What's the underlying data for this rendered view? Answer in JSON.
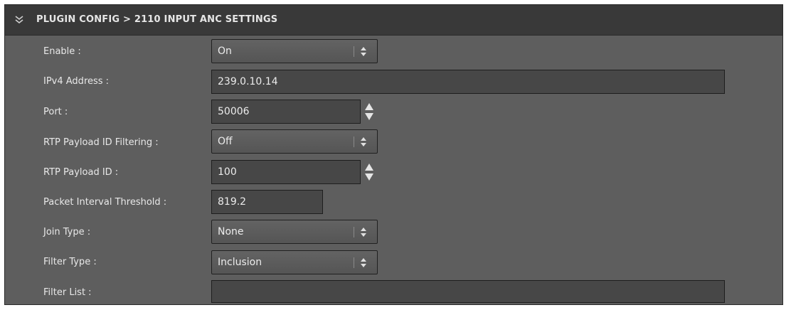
{
  "header": {
    "title": "PLUGIN CONFIG > 2110 INPUT ANC SETTINGS",
    "collapse_icon": "double-chevron-down-icon"
  },
  "colors": {
    "panel_bg": "#5e5e5e",
    "header_bg": "#393939",
    "field_bg": "#474747",
    "text": "#e8e8e8"
  },
  "fields": {
    "enable": {
      "label": "Enable :",
      "value": "On"
    },
    "ipv4_address": {
      "label": "IPv4 Address :",
      "value": "239.0.10.14"
    },
    "port": {
      "label": "Port :",
      "value": "50006"
    },
    "rtp_payload_filtering": {
      "label": "RTP Payload ID Filtering :",
      "value": "Off"
    },
    "rtp_payload_id": {
      "label": "RTP Payload ID :",
      "value": "100"
    },
    "packet_interval_threshold": {
      "label": "Packet Interval Threshold :",
      "value": "819.2"
    },
    "join_type": {
      "label": "Join Type :",
      "value": "None"
    },
    "filter_type": {
      "label": "Filter Type :",
      "value": "Inclusion"
    },
    "filter_list": {
      "label": "Filter List :",
      "value": ""
    }
  }
}
